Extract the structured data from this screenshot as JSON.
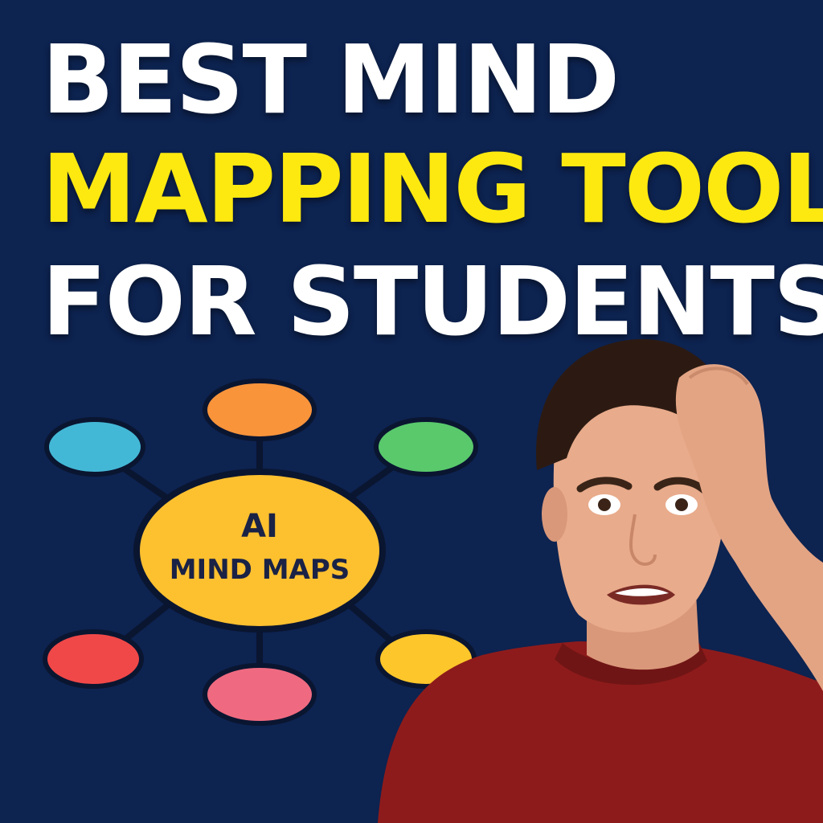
{
  "headline": {
    "line1": "BEST MIND",
    "line2": "MAPPING TOOL",
    "line3": "FOR STUDENTS"
  },
  "mindmap": {
    "center_line1": "AI",
    "center_line2": "MIND MAPS",
    "center_color": "#fdc02f",
    "node_colors": [
      "#f9943b",
      "#43b8d6",
      "#59c96c",
      "#f04848",
      "#ef6a80",
      "#fdc62a"
    ]
  },
  "colors": {
    "background": "#0d2350",
    "headline_white": "#ffffff",
    "headline_yellow": "#fde910",
    "shirt": "#8e1b1b"
  }
}
